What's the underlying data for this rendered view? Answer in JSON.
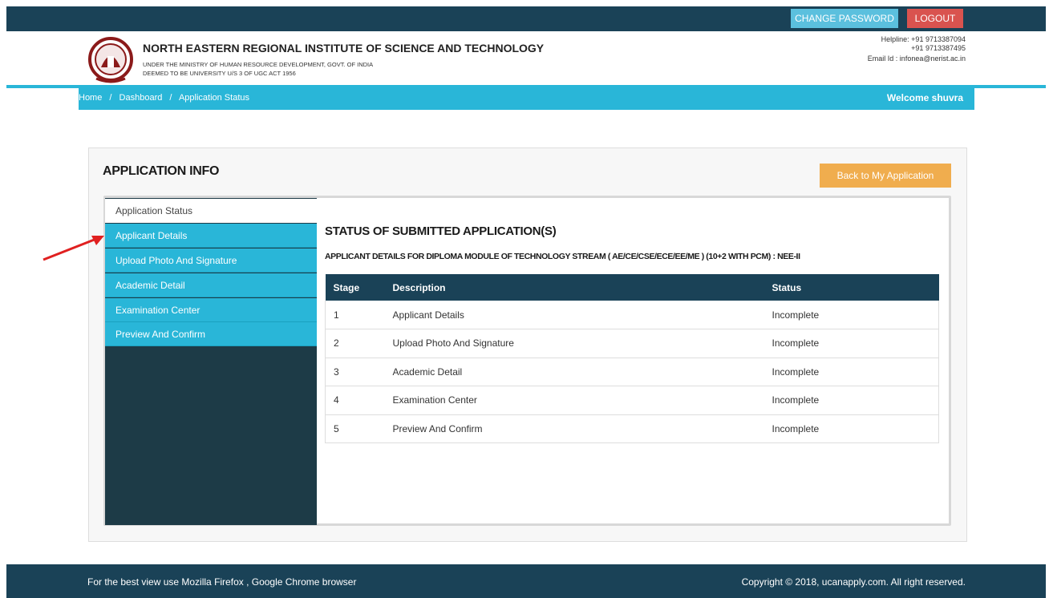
{
  "header": {
    "change_password": "CHANGE PASSWORD",
    "logout": "LOGOUT",
    "institute_title": "NORTH EASTERN REGIONAL INSTITUTE OF SCIENCE AND TECHNOLOGY",
    "subtitle_1": "UNDER THE MINISTRY OF HUMAN RESOURCE DEVELOPMENT, GOVT. OF INDIA",
    "subtitle_2": "DEEMED TO BE UNIVERSITY U/S 3 OF UGC ACT 1956",
    "helpline_1": "Helpline: +91 9713387094",
    "helpline_2": "+91 9713387495",
    "email": "Email Id : infonea@nerist.ac.in"
  },
  "breadcrumb": {
    "home": "Home",
    "dashboard": "Dashboard",
    "current": "Application Status",
    "separator": "/",
    "welcome": "Welcome shuvra"
  },
  "panel": {
    "title": "APPLICATION INFO",
    "back_button": "Back to My Application"
  },
  "sidebar": {
    "items": [
      {
        "label": "Application Status"
      },
      {
        "label": "Applicant Details"
      },
      {
        "label": "Upload Photo And Signature"
      },
      {
        "label": "Academic Detail"
      },
      {
        "label": "Examination Center"
      },
      {
        "label": "Preview And Confirm"
      }
    ]
  },
  "content": {
    "title": "STATUS OF SUBMITTED APPLICATION(S)",
    "subtitle": "APPLICANT DETAILS FOR DIPLOMA MODULE OF TECHNOLOGY STREAM ( AE/CE/CSE/ECE/EE/ME ) (10+2 WITH PCM) : NEE-II",
    "table": {
      "headers": [
        "Stage",
        "Description",
        "Status"
      ],
      "rows": [
        {
          "stage": "1",
          "description": "Applicant Details",
          "status": "Incomplete"
        },
        {
          "stage": "2",
          "description": "Upload Photo And Signature",
          "status": "Incomplete"
        },
        {
          "stage": "3",
          "description": "Academic Detail",
          "status": "Incomplete"
        },
        {
          "stage": "4",
          "description": "Examination Center",
          "status": "Incomplete"
        },
        {
          "stage": "5",
          "description": "Preview And Confirm",
          "status": "Incomplete"
        }
      ]
    }
  },
  "footer": {
    "left": "For the best view use Mozilla Firefox , Google Chrome browser",
    "right": "Copyright © 2018, ucanapply.com. All right reserved."
  },
  "colors": {
    "navy": "#1a4257",
    "cyan": "#29b6d8",
    "orange": "#f0ad4e",
    "red": "#d9534f",
    "sidebar_dark": "#1d3b47"
  }
}
